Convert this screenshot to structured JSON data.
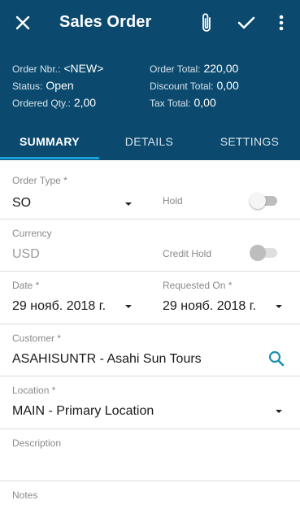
{
  "header": {
    "title": "Sales Order",
    "icons": {
      "close": "close-icon",
      "attach": "paperclip-icon",
      "save": "check-icon",
      "more": "more-vert-icon"
    },
    "background": "#0b4a6e"
  },
  "summary": {
    "order_nbr_label": "Order Nbr.:",
    "order_nbr": "<NEW>",
    "status_label": "Status:",
    "status": "Open",
    "ordered_qty_label": "Ordered Qty.:",
    "ordered_qty": "2,00",
    "order_total_label": "Order Total:",
    "order_total": "220,00",
    "discount_total_label": "Discount Total:",
    "discount_total": "0,00",
    "tax_total_label": "Tax Total:",
    "tax_total": "0,00"
  },
  "tabs": [
    {
      "label": "SUMMARY",
      "active": true
    },
    {
      "label": "DETAILS",
      "active": false
    },
    {
      "label": "SETTINGS",
      "active": false
    }
  ],
  "form": {
    "order_type": {
      "label": "Order Type *",
      "value": "SO"
    },
    "hold": {
      "label": "Hold",
      "on": false
    },
    "currency": {
      "label": "Currency",
      "value": "USD"
    },
    "credit_hold": {
      "label": "Credit Hold",
      "on": false
    },
    "date": {
      "label": "Date *",
      "value": "29 нояб. 2018 г."
    },
    "requested_on": {
      "label": "Requested On *",
      "value": "29 нояб. 2018 г."
    },
    "customer": {
      "label": "Customer *",
      "value": "ASAHISUNTR - Asahi Sun Tours",
      "icon": "search-icon"
    },
    "location": {
      "label": "Location *",
      "value": "MAIN - Primary Location"
    },
    "description": {
      "label": "Description",
      "value": ""
    },
    "notes": {
      "label": "Notes",
      "value": ""
    }
  },
  "colors": {
    "accent": "#1aa0d8",
    "search_icon": "#1a8fb0"
  }
}
